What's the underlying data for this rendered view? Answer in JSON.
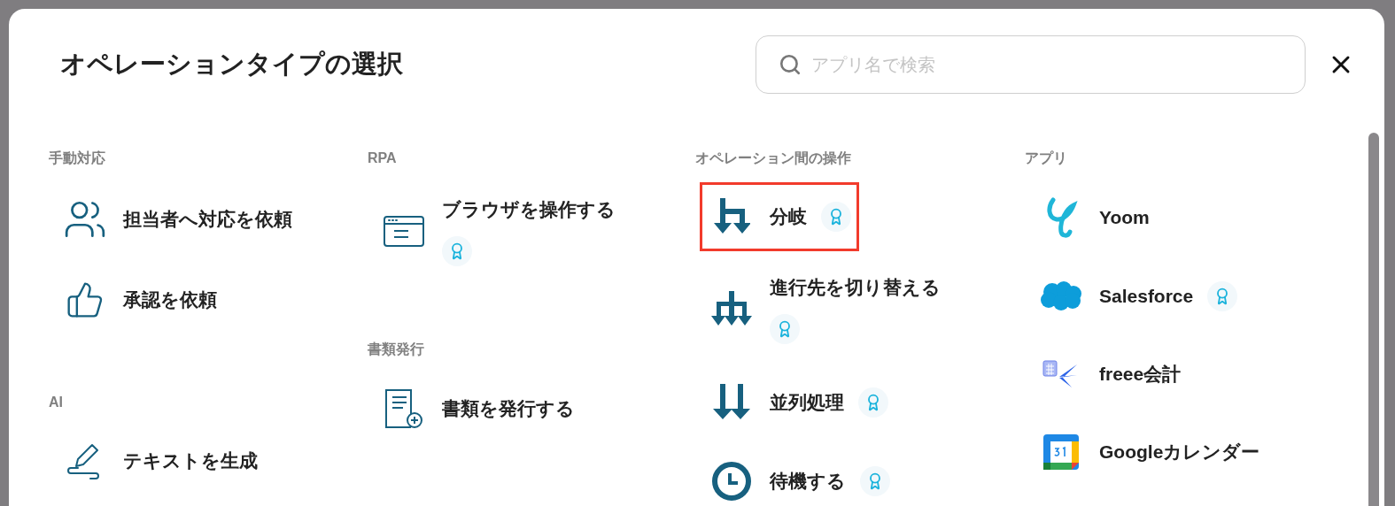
{
  "dialog": {
    "title": "オペレーションタイプの選択",
    "search": {
      "placeholder": "アプリ名で検索"
    }
  },
  "columns": [
    {
      "sections": [
        {
          "heading": "手動対応",
          "items": [
            {
              "label": "担当者へ対応を依頼",
              "kind": "people",
              "badge": false,
              "highlighted": false
            },
            {
              "label": "承認を依頼",
              "kind": "thumbs",
              "badge": false,
              "highlighted": false
            }
          ]
        },
        {
          "heading": "AI",
          "items": [
            {
              "label": "テキストを生成",
              "kind": "pen",
              "badge": false,
              "highlighted": false
            }
          ]
        }
      ]
    },
    {
      "sections": [
        {
          "heading": "RPA",
          "items": [
            {
              "label": "ブラウザを操作する",
              "kind": "browser",
              "badge": true,
              "highlighted": false
            }
          ]
        },
        {
          "heading": "書類発行",
          "items": [
            {
              "label": "書類を発行する",
              "kind": "document",
              "badge": false,
              "highlighted": false
            }
          ]
        }
      ]
    },
    {
      "sections": [
        {
          "heading": "オペレーション間の操作",
          "items": [
            {
              "label": "分岐",
              "kind": "branch",
              "badge": true,
              "highlighted": true
            },
            {
              "label": "進行先を切り替える",
              "kind": "switch",
              "badge": true,
              "highlighted": false
            },
            {
              "label": "並列処理",
              "kind": "parallel",
              "badge": true,
              "highlighted": false
            },
            {
              "label": "待機する",
              "kind": "clock",
              "badge": true,
              "highlighted": false
            }
          ]
        }
      ]
    },
    {
      "sections": [
        {
          "heading": "アプリ",
          "items": [
            {
              "label": "Yoom",
              "kind": "yoom",
              "badge": false,
              "highlighted": false
            },
            {
              "label": "Salesforce",
              "kind": "cloud",
              "badge": true,
              "highlighted": false
            },
            {
              "label": "freee会計",
              "kind": "freee",
              "badge": false,
              "highlighted": false
            },
            {
              "label": "Googleカレンダー",
              "kind": "calendar",
              "badge": false,
              "highlighted": false
            }
          ]
        }
      ]
    }
  ]
}
